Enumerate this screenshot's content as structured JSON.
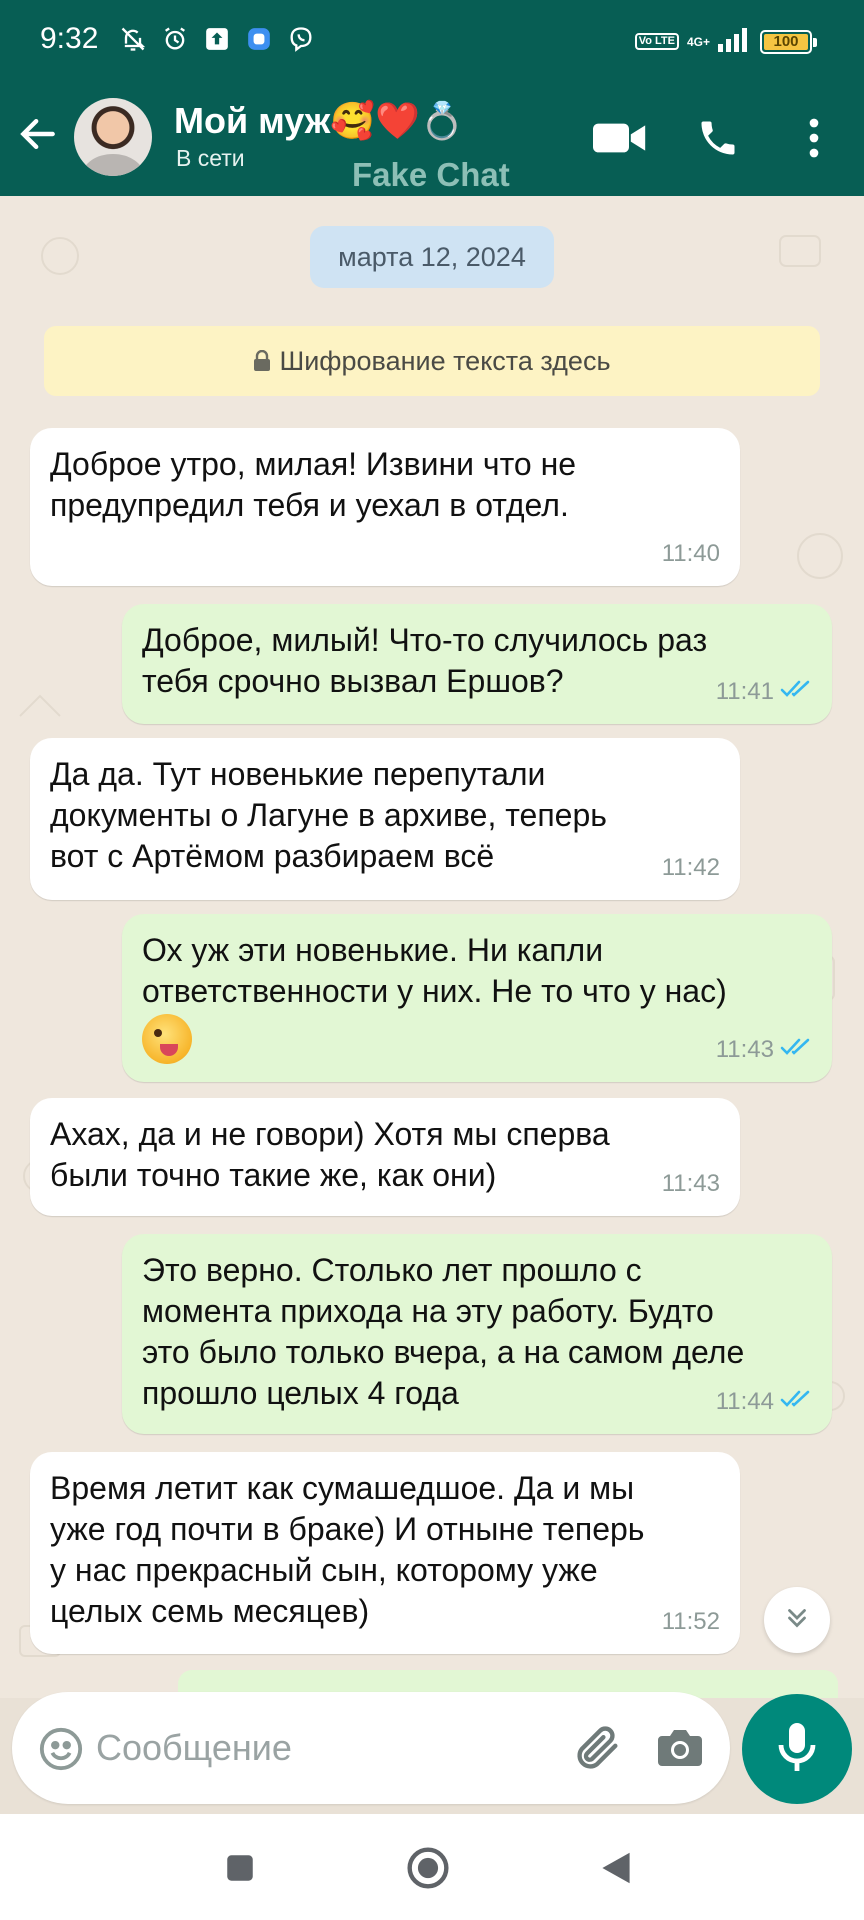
{
  "status_bar": {
    "time": "9:32",
    "volte": "Vo LTE",
    "network": "4G+",
    "battery": "100"
  },
  "header": {
    "contact_name": "Мой муж🥰❤️💍",
    "contact_status": "В сети",
    "watermark": "Fake Chat"
  },
  "chat": {
    "date": "марта 12, 2024",
    "encryption_notice": "Шифрование текста здесь",
    "messages": [
      {
        "direction": "in",
        "text": "Доброе утро, милая! Извини что не\nпредупредил тебя и уехал в отдел.",
        "time": "11:40"
      },
      {
        "direction": "out",
        "text": "Доброе, милый! Что-то случилось раз\nтебя срочно вызвал Ершов?",
        "time": "11:41",
        "read": true
      },
      {
        "direction": "in",
        "text": "Да да. Тут новенькие перепутали\nдокументы о Лагуне в архиве, теперь\nвот с Артёмом разбираем всё",
        "time": "11:42"
      },
      {
        "direction": "out",
        "text": "Ох уж эти новенькие. Ни капли\nответственности у них. Не то что у нас)",
        "emoji": "winking-face-with-tongue",
        "time": "11:43",
        "read": true
      },
      {
        "direction": "in",
        "text": "Ахах, да и не говори) Хотя мы сперва\nбыли точно такие же, как они)",
        "time": "11:43"
      },
      {
        "direction": "out",
        "text": "Это верно. Столько лет прошло с\nмомента прихода на эту работу. Будто\nэто было только вчера, а на самом деле\nпрошло целых 4 года",
        "time": "11:44",
        "read": true
      },
      {
        "direction": "in",
        "text": "Время летит как сумашедшое. Да и мы\nуже год  почти в браке) И отныне теперь\nу нас прекрасный сын, которому уже\nцелых семь месяцев)",
        "time": "11:52"
      }
    ]
  },
  "composer": {
    "placeholder": "Сообщение"
  },
  "colors": {
    "header": "#075e54",
    "incoming": "#ffffff",
    "outgoing": "#e2f7d4",
    "accent": "#00897b",
    "read_ticks": "#34b7f1"
  }
}
